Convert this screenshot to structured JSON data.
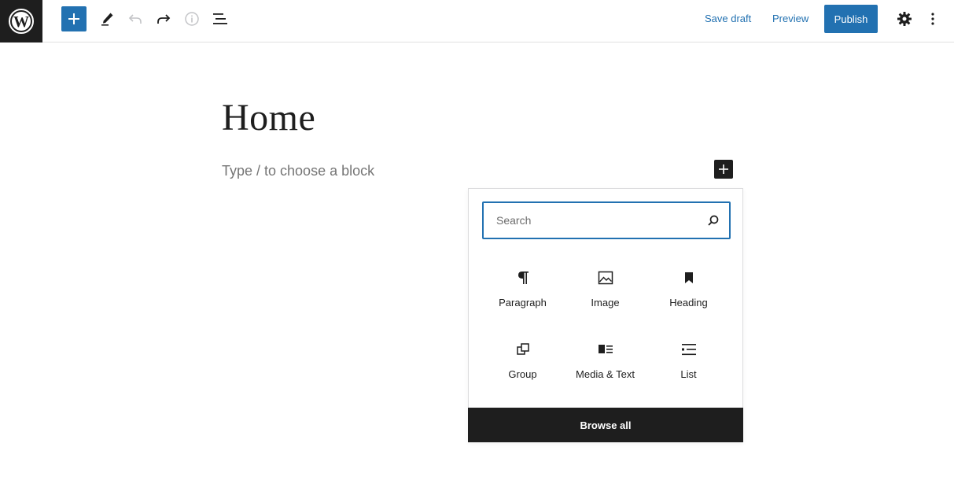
{
  "toolbar": {
    "logo_icon": "wordpress-icon",
    "add_block_icon": "plus-icon",
    "tools_icon": "pencil-icon",
    "undo_icon": "undo-icon",
    "redo_icon": "redo-icon",
    "details_icon": "info-icon",
    "outline_icon": "list-view-icon",
    "save_draft_label": "Save draft",
    "preview_label": "Preview",
    "publish_label": "Publish",
    "settings_icon": "gear-icon",
    "options_icon": "vertical-ellipsis-icon",
    "accent_color": "#2271b1"
  },
  "editor": {
    "title": "Home",
    "block_placeholder": "Type / to choose a block"
  },
  "inserter": {
    "search_placeholder": "Search",
    "search_value": "",
    "blocks": [
      {
        "label": "Paragraph",
        "icon": "paragraph-icon"
      },
      {
        "label": "Image",
        "icon": "image-icon"
      },
      {
        "label": "Heading",
        "icon": "bookmark-icon"
      },
      {
        "label": "Group",
        "icon": "group-icon"
      },
      {
        "label": "Media & Text",
        "icon": "media-text-icon"
      },
      {
        "label": "List",
        "icon": "list-icon"
      }
    ],
    "browse_all_label": "Browse all"
  }
}
